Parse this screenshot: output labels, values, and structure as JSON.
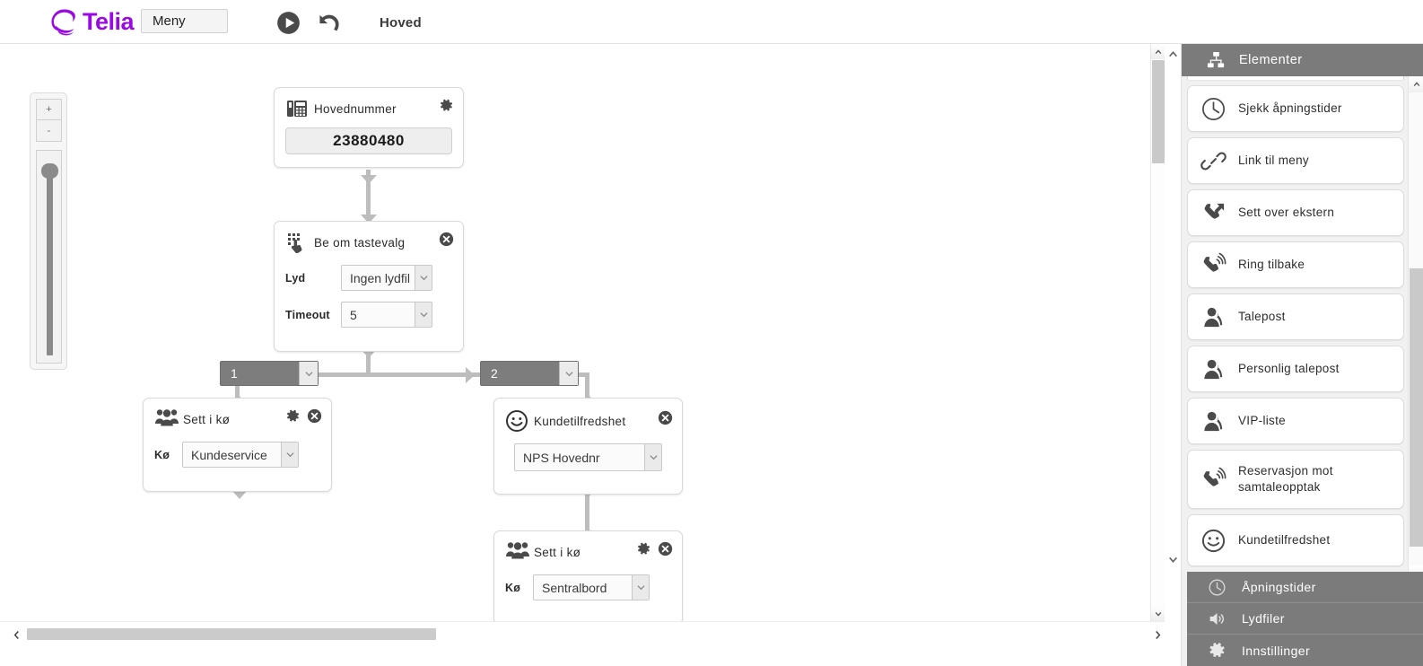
{
  "topbar": {
    "brand": "Telia",
    "menu_button": "Meny",
    "play_icon": "play-icon",
    "undo_icon": "undo-icon",
    "page_title": "Hoved"
  },
  "canvas": {
    "zoom_in": "+",
    "zoom_out": "-",
    "nodes": [
      {
        "id": "hovednummer",
        "icon": "desk-phone-icon",
        "title": "Hovednummer",
        "settings_icon": "gear-icon",
        "number": "23880480"
      },
      {
        "id": "be-om-tastevalg",
        "icon": "keypad-touch-icon",
        "title": "Be om tastevalg",
        "close_icon": "close-circle-icon",
        "fields": [
          {
            "label": "Lyd",
            "value": "Ingen lydfil"
          },
          {
            "label": "Timeout",
            "value": "5"
          }
        ]
      },
      {
        "id": "sett-i-ko-1",
        "icon": "group-people-icon",
        "title": "Sett i kø",
        "settings_icon": "gear-icon",
        "close_icon": "close-circle-icon",
        "fields": [
          {
            "label": "Kø",
            "value": "Kundeservice"
          }
        ]
      },
      {
        "id": "kundetilfredshet",
        "icon": "smiley-icon",
        "title": "Kundetilfredshet",
        "close_icon": "close-circle-icon",
        "fields": [
          {
            "label": "",
            "value": "NPS Hovednr"
          }
        ]
      },
      {
        "id": "sett-i-ko-2",
        "icon": "group-people-icon",
        "title": "Sett i kø",
        "settings_icon": "gear-icon",
        "close_icon": "close-circle-icon",
        "fields": [
          {
            "label": "Kø",
            "value": "Sentralbord"
          }
        ]
      }
    ],
    "branches": [
      {
        "value": "1"
      },
      {
        "value": "2"
      }
    ]
  },
  "sidebar": {
    "header": {
      "icon": "sitemap-icon",
      "title": "Elementer"
    },
    "items": [
      {
        "icon": "clock-icon",
        "label": "Sjekk åpningstider"
      },
      {
        "icon": "link-icon",
        "label": "Link til meny"
      },
      {
        "icon": "phone-forward-icon",
        "label": "Sett over ekstern"
      },
      {
        "icon": "phone-ring-icon",
        "label": "Ring tilbake"
      },
      {
        "icon": "person-icon",
        "label": "Talepost"
      },
      {
        "icon": "person-icon",
        "label": "Personlig talepost"
      },
      {
        "icon": "person-icon",
        "label": "VIP-liste"
      },
      {
        "icon": "phone-ring-icon",
        "label": "Reservasjon mot samtaleopptak"
      },
      {
        "icon": "smiley-icon",
        "label": "Kundetilfredshet"
      }
    ],
    "bottom_menu": [
      {
        "icon": "clock-icon",
        "label": "Åpningstider"
      },
      {
        "icon": "speaker-icon",
        "label": "Lydfiler"
      },
      {
        "icon": "gear-icon",
        "label": "Innstillinger"
      }
    ]
  },
  "colors": {
    "brand": "#990ae3",
    "panel_gray": "#7b7b7b",
    "connector": "#bdbdbd"
  }
}
